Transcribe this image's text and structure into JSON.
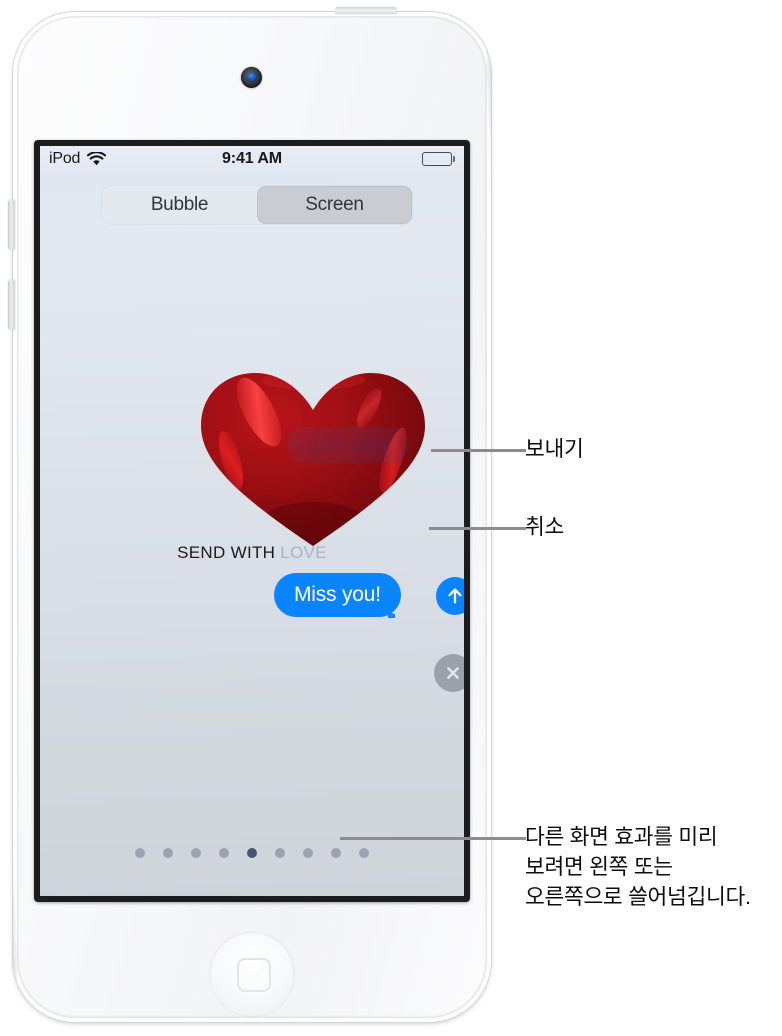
{
  "device": {
    "name": "ipod-touch-white",
    "camera": "front-camera",
    "home_button": "home-button"
  },
  "screen": {
    "status_bar": {
      "carrier": "iPod",
      "wifi_icon": "wifi-icon",
      "time": "9:41 AM",
      "battery_icon": "battery-full-icon"
    },
    "segmented_control": {
      "options": [
        {
          "label": "Bubble",
          "selected": false
        },
        {
          "label": "Screen",
          "selected": true
        }
      ]
    },
    "effect_preview": {
      "effect_name": "SEND WITH LOVE",
      "effect_name_primary": "SEND WITH",
      "effect_name_secondary": "LOVE",
      "balloon_icon": "heart-balloon-icon",
      "balloon_color": "#a60d12",
      "ghost_bubble_text": "Miss you!"
    },
    "message": {
      "text": "Miss you!",
      "bubble_color": "#0b84ff",
      "bubble_text_color": "#ffffff"
    },
    "actions": [
      {
        "name": "send-button",
        "icon": "arrow-up-icon",
        "color": "#0b84ff"
      },
      {
        "name": "cancel-button",
        "icon": "close-x-icon",
        "color": "#9aa1ab"
      }
    ],
    "page_dots": {
      "count": 9,
      "active_index": 4,
      "dot_color": "#99a3b4",
      "active_color": "#47556c"
    }
  },
  "callouts": [
    {
      "id": "send",
      "text": "보내기",
      "target": "send-button"
    },
    {
      "id": "cancel",
      "text": "취소",
      "target": "cancel-button"
    },
    {
      "id": "swipe",
      "lines": [
        "다른 화면 효과를 미리",
        "보려면 왼쪽 또는",
        "오른쪽으로 쓸어넘깁니다."
      ],
      "target": "page-dots"
    }
  ]
}
